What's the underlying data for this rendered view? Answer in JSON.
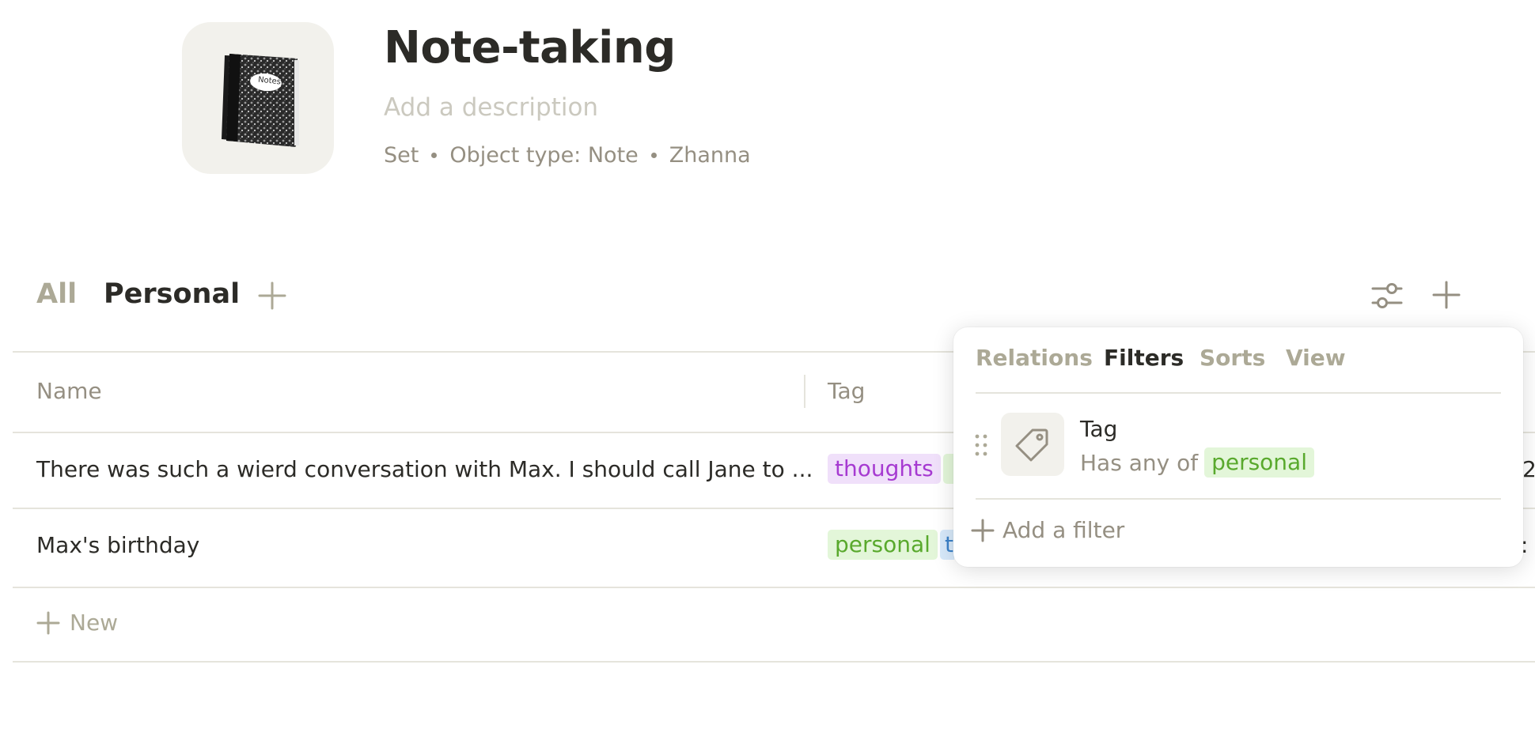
{
  "header": {
    "title": "Note-taking",
    "description_placeholder": "Add a description",
    "meta": {
      "kind": "Set",
      "object_type": "Object type: Note",
      "author": "Zhanna"
    },
    "cover_icon": "composition-notebook-icon",
    "cover_label": "Notes"
  },
  "views": {
    "tabs": [
      {
        "label": "All",
        "active": false
      },
      {
        "label": "Personal",
        "active": true
      }
    ],
    "add_icon": "plus-icon",
    "settings_icon": "sliders-icon",
    "new_icon": "plus-icon"
  },
  "table": {
    "columns": [
      "Name",
      "Tag"
    ],
    "rows": [
      {
        "name": "There was such a wierd conversation with Max. I should call Jane to ...",
        "tags": [
          {
            "label": "thoughts",
            "color": "purple"
          }
        ],
        "edge_text": "2"
      },
      {
        "name": "Max's birthday",
        "tags": [
          {
            "label": "personal",
            "color": "green"
          },
          {
            "label": "t",
            "color": "blue"
          }
        ],
        "edge_text": ":"
      }
    ],
    "new_label": "New"
  },
  "popup": {
    "tabs": [
      {
        "label": "Relations",
        "active": false
      },
      {
        "label": "Filters",
        "active": true
      },
      {
        "label": "Sorts",
        "active": false
      },
      {
        "label": "View",
        "active": false
      }
    ],
    "filter": {
      "relation": "Tag",
      "condition": "Has any of",
      "value": "personal",
      "icon": "tag-icon"
    },
    "add_filter_label": "Add a filter"
  },
  "colors": {
    "text": "#2c2b27",
    "muted": "#958f82",
    "light": "#aca996",
    "border": "#e5e4dc",
    "tag_purple_bg": "#f0e0fa",
    "tag_purple_fg": "#a63ad1",
    "tag_green_bg": "#e3f6d9",
    "tag_green_fg": "#59a92d",
    "tag_blue_bg": "#d7e9fa"
  }
}
